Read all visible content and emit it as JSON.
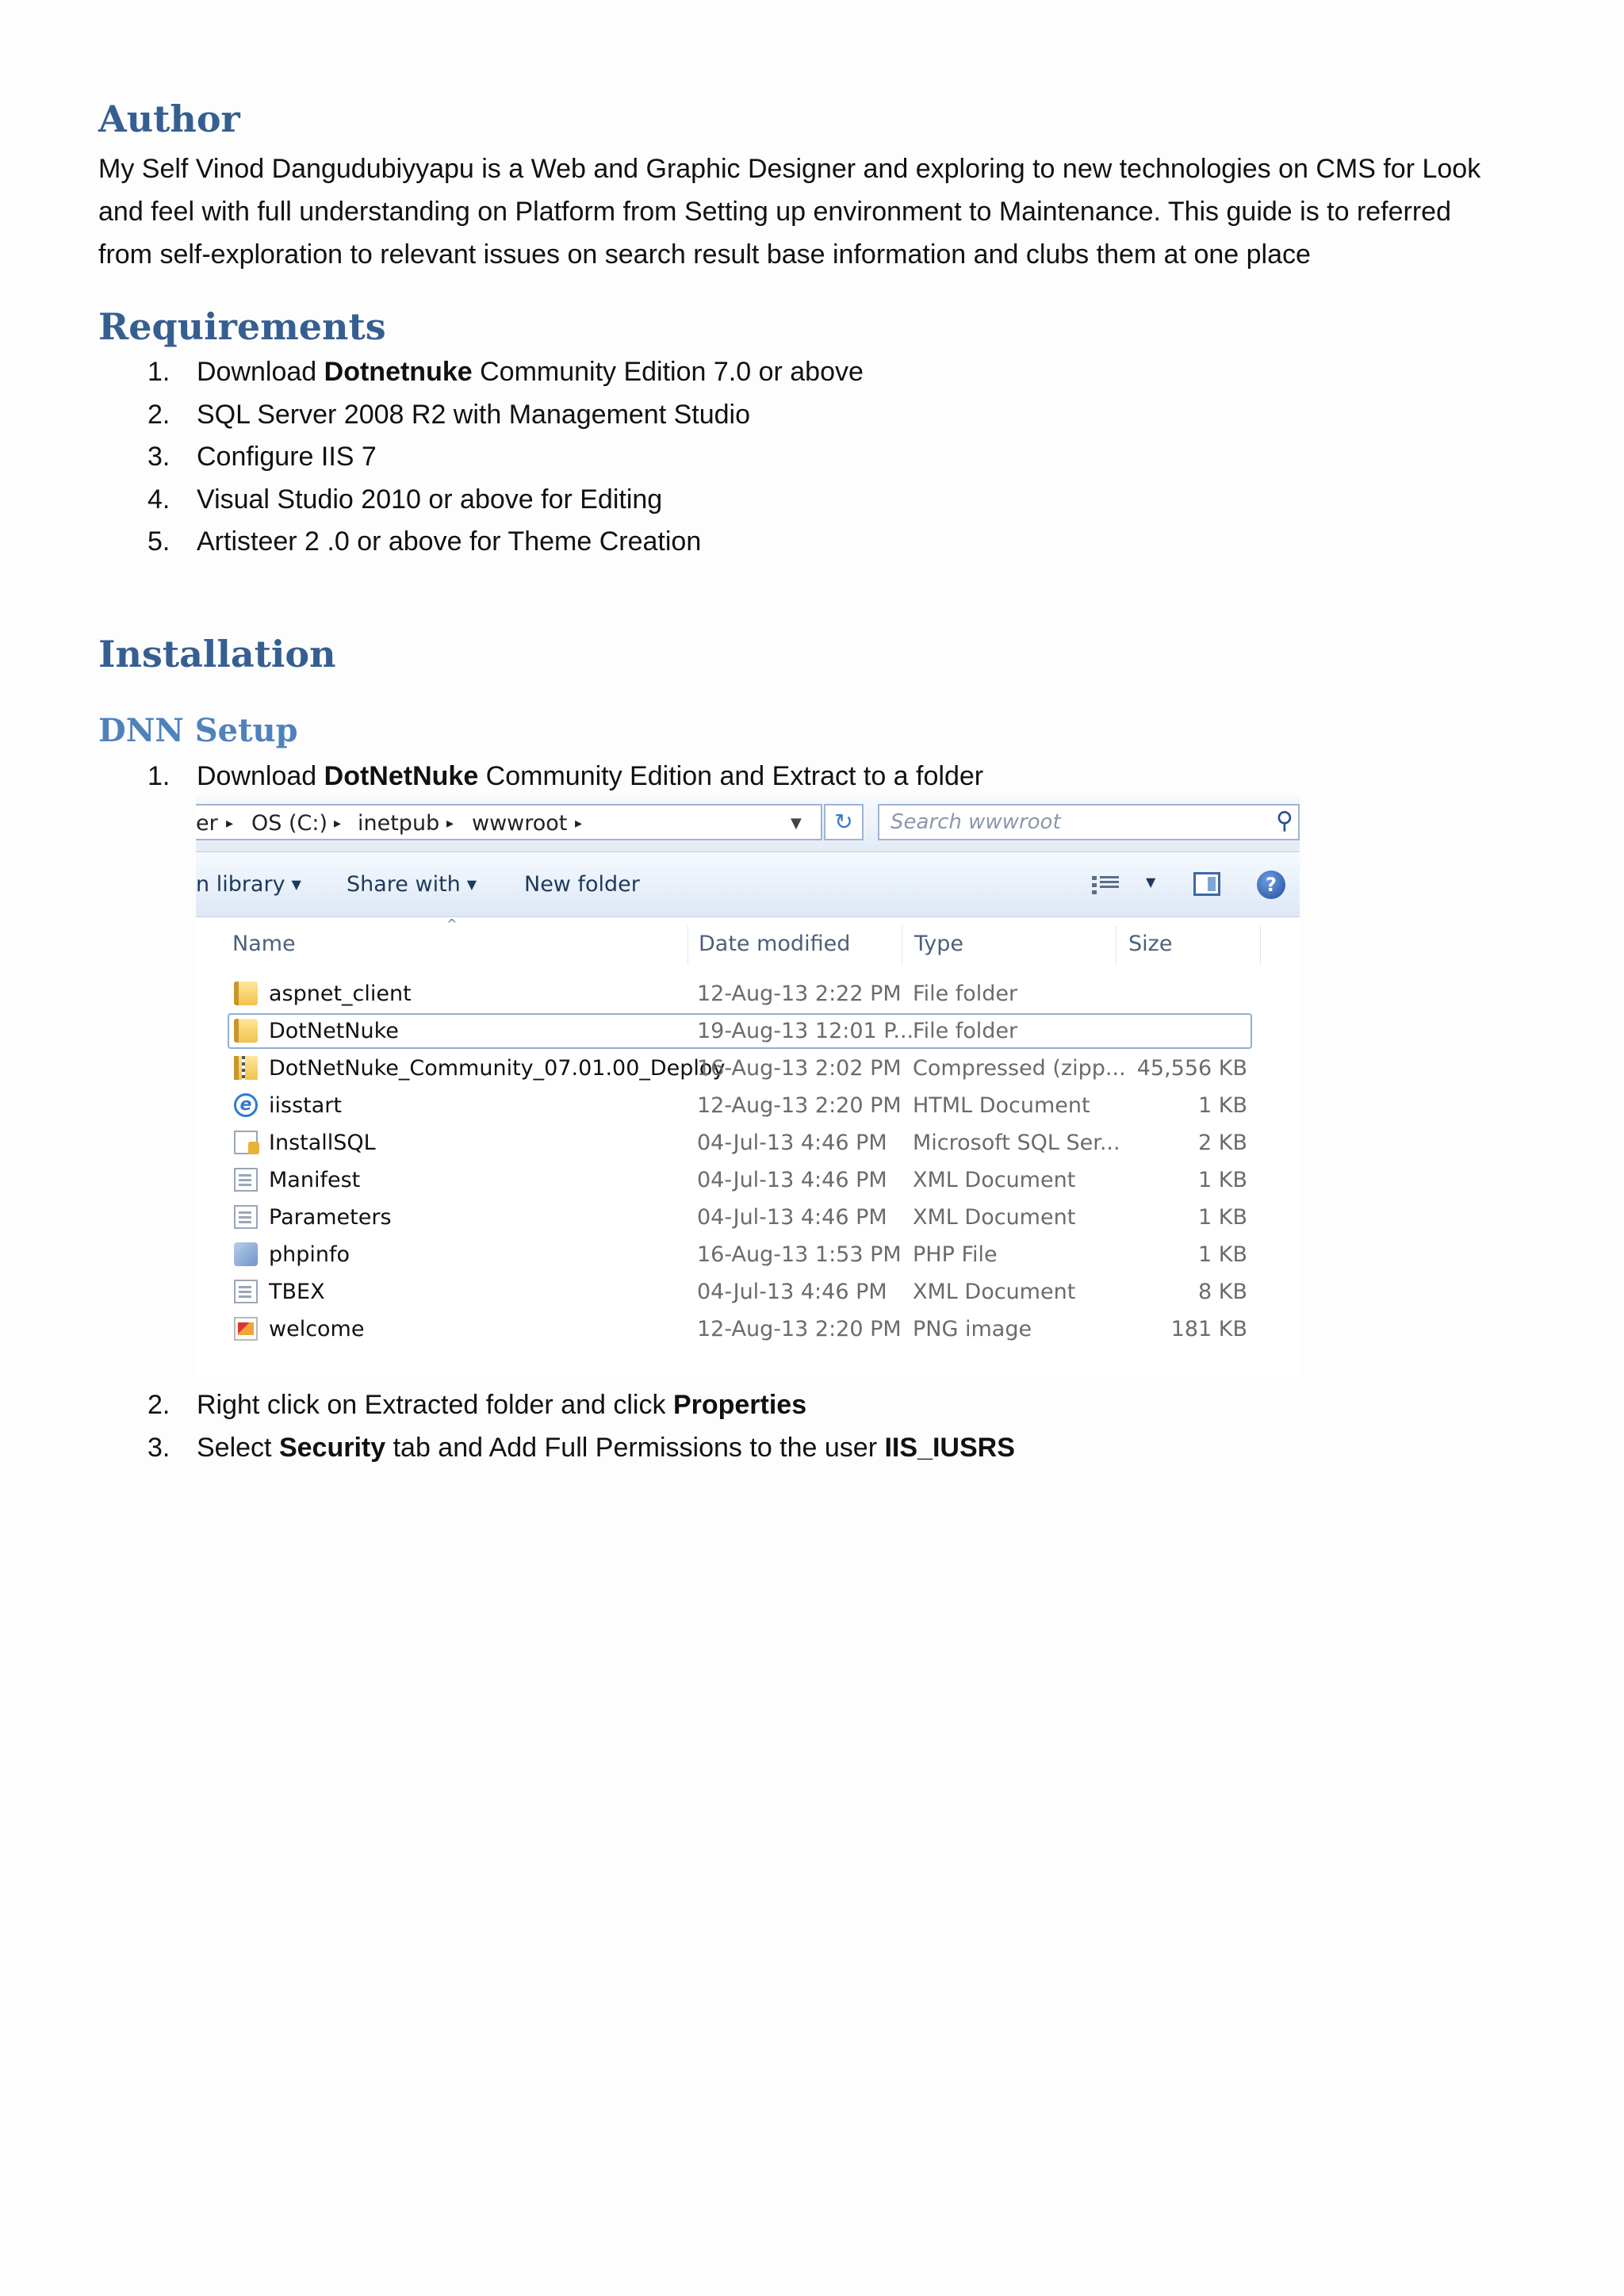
{
  "author": {
    "heading": "Author",
    "lines": [
      "My Self Vinod Dangudubiyyapu is a Web and Graphic Designer and exploring to new technologies on CMS for Look",
      "and feel with full understanding on Platform from Setting up environment to Maintenance. This guide is to referred",
      "from self-exploration to relevant issues on search result base information and clubs them at one place"
    ]
  },
  "requirements": {
    "heading": "Requirements",
    "items": [
      {
        "num": "1.",
        "pre": "Download ",
        "bold": "Dotnetnuke",
        "post": " Community Edition 7.0 or above"
      },
      {
        "num": "2.",
        "pre": "SQL Server 2008 R2 with Management Studio",
        "bold": "",
        "post": ""
      },
      {
        "num": "3.",
        "pre": "Configure IIS 7",
        "bold": "",
        "post": ""
      },
      {
        "num": "4.",
        "pre": "Visual Studio 2010 or above for Editing",
        "bold": "",
        "post": ""
      },
      {
        "num": "5.",
        "pre": "Artisteer 2 .0 or above for Theme Creation",
        "bold": "",
        "post": ""
      }
    ]
  },
  "installation": {
    "heading": "Installation",
    "subheading": "DNN Setup",
    "step1": {
      "num": "1.",
      "pre": "Download ",
      "bold": "DotNetNuke",
      "post": " Community Edition and Extract to a folder"
    },
    "step2": {
      "num": "2.",
      "pre": "Right click on Extracted folder and click ",
      "bold": "Properties"
    },
    "step3": {
      "num": "3.",
      "pre": "Select ",
      "bold1": "Security",
      "mid": " tab and Add Full Permissions to the user ",
      "bold2": "IIS_IUSRS"
    }
  },
  "explorer": {
    "breadcrumb": [
      "er",
      "OS (C:)",
      "inetpub",
      "wwwroot"
    ],
    "search_placeholder": "Search wwwroot",
    "toolbar": {
      "library": "n library",
      "share": "Share with",
      "new_folder": "New folder"
    },
    "columns": {
      "name": "Name",
      "date": "Date modified",
      "type": "Type",
      "size": "Size"
    },
    "files": [
      {
        "name": "aspnet_client",
        "date": "12-Aug-13 2:22 PM",
        "type": "File folder",
        "size": "",
        "icon": "folder-icon"
      },
      {
        "name": "DotNetNuke",
        "date": "19-Aug-13 12:01 P...",
        "type": "File folder",
        "size": "",
        "icon": "folder-icon"
      },
      {
        "name": "DotNetNuke_Community_07.01.00_Deploy",
        "date": "16-Aug-13 2:02 PM",
        "type": "Compressed (zipp...",
        "size": "45,556 KB",
        "icon": "zip-icon"
      },
      {
        "name": "iisstart",
        "date": "12-Aug-13 2:20 PM",
        "type": "HTML Document",
        "size": "1 KB",
        "icon": "ie-icon"
      },
      {
        "name": "InstallSQL",
        "date": "04-Jul-13 4:46 PM",
        "type": "Microsoft SQL Ser...",
        "size": "2 KB",
        "icon": "sql-icon"
      },
      {
        "name": "Manifest",
        "date": "04-Jul-13 4:46 PM",
        "type": "XML Document",
        "size": "1 KB",
        "icon": "xml-icon"
      },
      {
        "name": "Parameters",
        "date": "04-Jul-13 4:46 PM",
        "type": "XML Document",
        "size": "1 KB",
        "icon": "xml-icon"
      },
      {
        "name": "phpinfo",
        "date": "16-Aug-13 1:53 PM",
        "type": "PHP File",
        "size": "1 KB",
        "icon": "php-icon"
      },
      {
        "name": "TBEX",
        "date": "04-Jul-13 4:46 PM",
        "type": "XML Document",
        "size": "8 KB",
        "icon": "xml-icon"
      },
      {
        "name": "welcome",
        "date": "12-Aug-13 2:20 PM",
        "type": "PNG image",
        "size": "181 KB",
        "icon": "png-icon"
      }
    ]
  },
  "colors": {
    "heading": "#365f91",
    "subheading": "#4f81bd"
  }
}
